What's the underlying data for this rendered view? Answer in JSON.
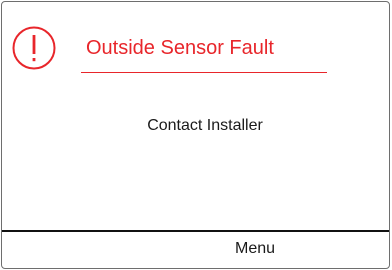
{
  "alert": {
    "icon": "exclamation-circle-icon",
    "title": "Outside Sensor Fault",
    "accent_color": "#e8262b"
  },
  "message": "Contact Installer",
  "footer": {
    "menu_label": "Menu"
  }
}
